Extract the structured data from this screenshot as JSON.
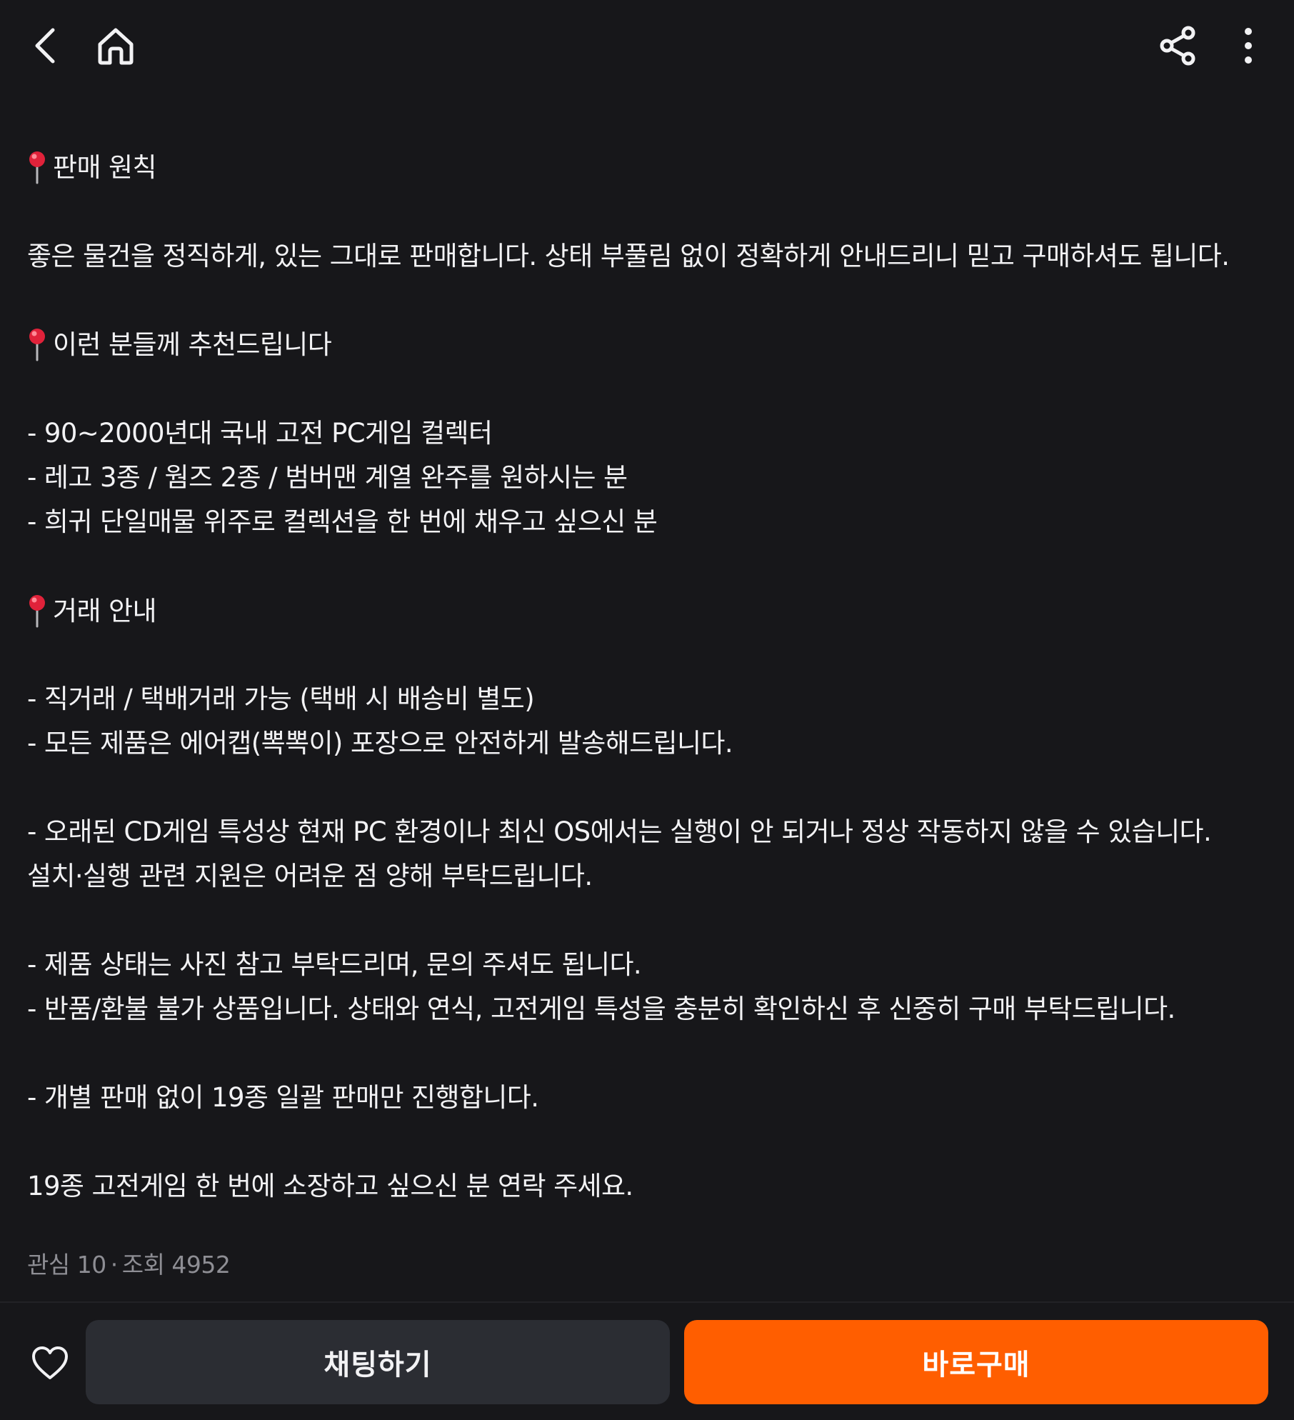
{
  "topbar": {
    "back_icon": "chevron-left-icon",
    "home_icon": "home-icon",
    "share_icon": "share-icon",
    "more_icon": "more-vertical-icon"
  },
  "description": {
    "section1_heading": "판매 원칙",
    "line_intro": "좋은 물건을 정직하게, 있는 그대로 판매합니다. 상태 부풀림 없이 정확하게 안내드리니 믿고 구매하셔도 됩니다.",
    "section2_heading": "이런 분들께 추천드립니다",
    "rec_1": "- 90~2000년대 국내 고전 PC게임 컬렉터",
    "rec_2": "- 레고 3종 / 웜즈 2종 / 범버맨 계열 완주를 원하시는 분",
    "rec_3": "- 희귀 단일매물 위주로 컬렉션을 한 번에 채우고 싶으신 분",
    "section3_heading": "거래 안내",
    "deal_1": "- 직거래 / 택배거래 가능 (택배 시 배송비 별도)",
    "deal_2": "- 모든 제품은 에어캡(뽁뽁이) 포장으로 안전하게 발송해드립니다.",
    "note_1a": "- 오래된 CD게임 특성상 현재 PC 환경이나 최신 OS에서는 실행이 안 되거나 정상 작동하지 않을 수 있습니다.",
    "note_1b": "설치·실행 관련 지원은 어려운 점 양해 부탁드립니다.",
    "note_2a": "- 제품 상태는 사진 참고 부탁드리며, 문의 주셔도 됩니다.",
    "note_2b": "- 반품/환불 불가 상품입니다. 상태와 연식, 고전게임 특성을 충분히 확인하신 후 신중히 구매 부탁드립니다.",
    "note_3": "- 개별 판매 없이 19종 일괄 판매만 진행합니다.",
    "closing": "19종 고전게임 한 번에 소장하고 싶으신 분 연락 주세요.",
    "pin_icon": "pushpin-icon"
  },
  "stats": {
    "interest_label": "관심 10",
    "separator": "·",
    "views_label": "조회 4952"
  },
  "bottombar": {
    "heart_icon": "heart-icon",
    "chat_label": "채팅하기",
    "buy_label": "바로구매"
  },
  "colors": {
    "background": "#17171a",
    "text": "#f2f2f4",
    "muted": "#8e8e94",
    "chat_button": "#2b2d33",
    "buy_button": "#ff5e00",
    "pin_red": "#e0223a"
  }
}
